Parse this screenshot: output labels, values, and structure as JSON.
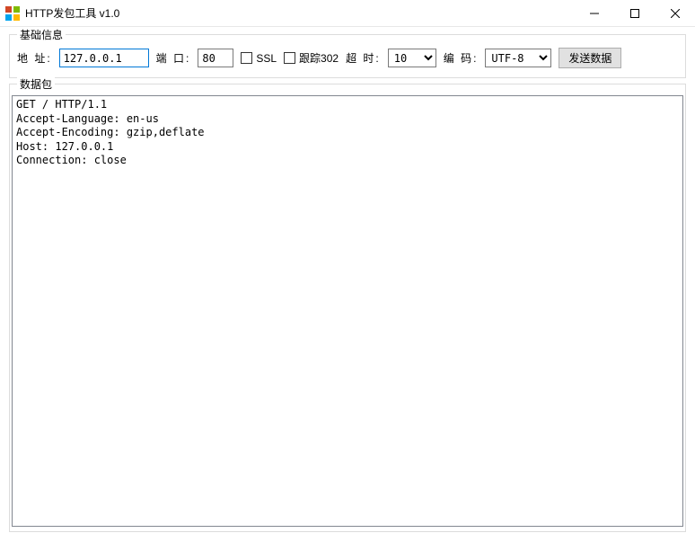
{
  "window": {
    "title": "HTTP发包工具 v1.0"
  },
  "basic_info": {
    "group_label": "基础信息",
    "address_label": "地 址:",
    "address_value": "127.0.0.1",
    "port_label": "端 口:",
    "port_value": "80",
    "ssl_label": "SSL",
    "ssl_checked": false,
    "follow302_label": "跟踪302",
    "follow302_checked": false,
    "timeout_label": "超 时:",
    "timeout_value": "10",
    "encoding_label": "编 码:",
    "encoding_value": "UTF-8",
    "send_button": "发送数据"
  },
  "data_packet": {
    "group_label": "数据包",
    "content": "GET / HTTP/1.1\nAccept-Language: en-us\nAccept-Encoding: gzip,deflate\nHost: 127.0.0.1\nConnection: close\n"
  }
}
